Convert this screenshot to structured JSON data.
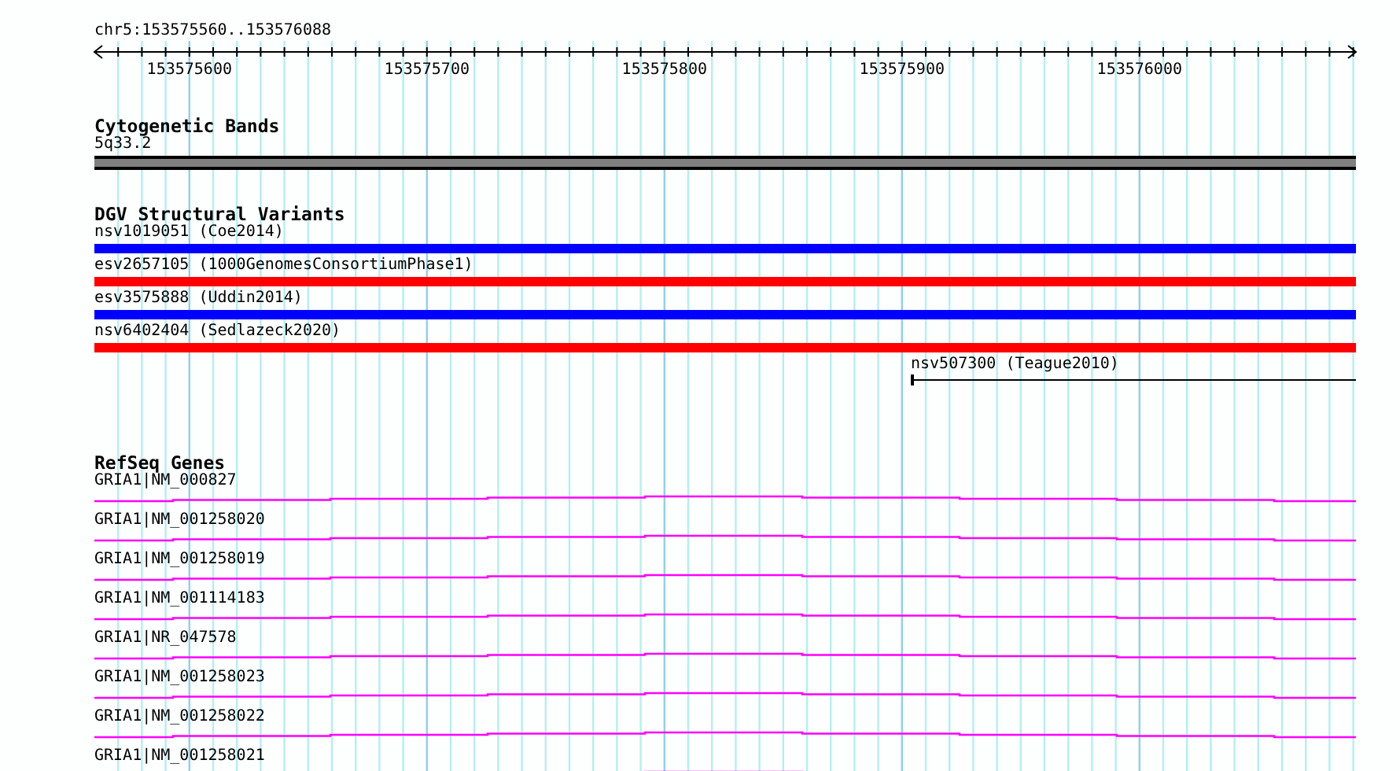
{
  "locus": "chr5:153575560..153576088",
  "ruler": {
    "tick_labels": [
      "153575600",
      "153575700",
      "153575800",
      "153575900",
      "153576000"
    ]
  },
  "cytogenetic_bands": {
    "title": "Cytogenetic Bands",
    "label": "5q33.2"
  },
  "dgv_structural_variants": {
    "title": "DGV Structural Variants",
    "features": [
      {
        "label": "nsv1019051 (Coe2014)",
        "kind": "bar",
        "color": "#0000ff"
      },
      {
        "label": "esv2657105 (1000GenomesConsortiumPhase1)",
        "kind": "bar",
        "color": "#ff0000"
      },
      {
        "label": "esv3575888 (Uddin2014)",
        "kind": "bar",
        "color": "#0000ff"
      },
      {
        "label": "nsv6402404 (Sedlazeck2020)",
        "kind": "bar",
        "color": "#ff0000"
      },
      {
        "label": "nsv507300 (Teague2010)",
        "kind": "line",
        "color": "#000000"
      }
    ]
  },
  "refseq_genes": {
    "title": "RefSeq Genes",
    "genes": [
      {
        "label": "GRIA1|NM_000827"
      },
      {
        "label": "GRIA1|NM_001258020"
      },
      {
        "label": "GRIA1|NM_001258019"
      },
      {
        "label": "GRIA1|NM_001114183"
      },
      {
        "label": "GRIA1|NR_047578"
      },
      {
        "label": "GRIA1|NM_001258023"
      },
      {
        "label": "GRIA1|NM_001258022"
      },
      {
        "label": "GRIA1|NM_001258021"
      }
    ]
  }
}
